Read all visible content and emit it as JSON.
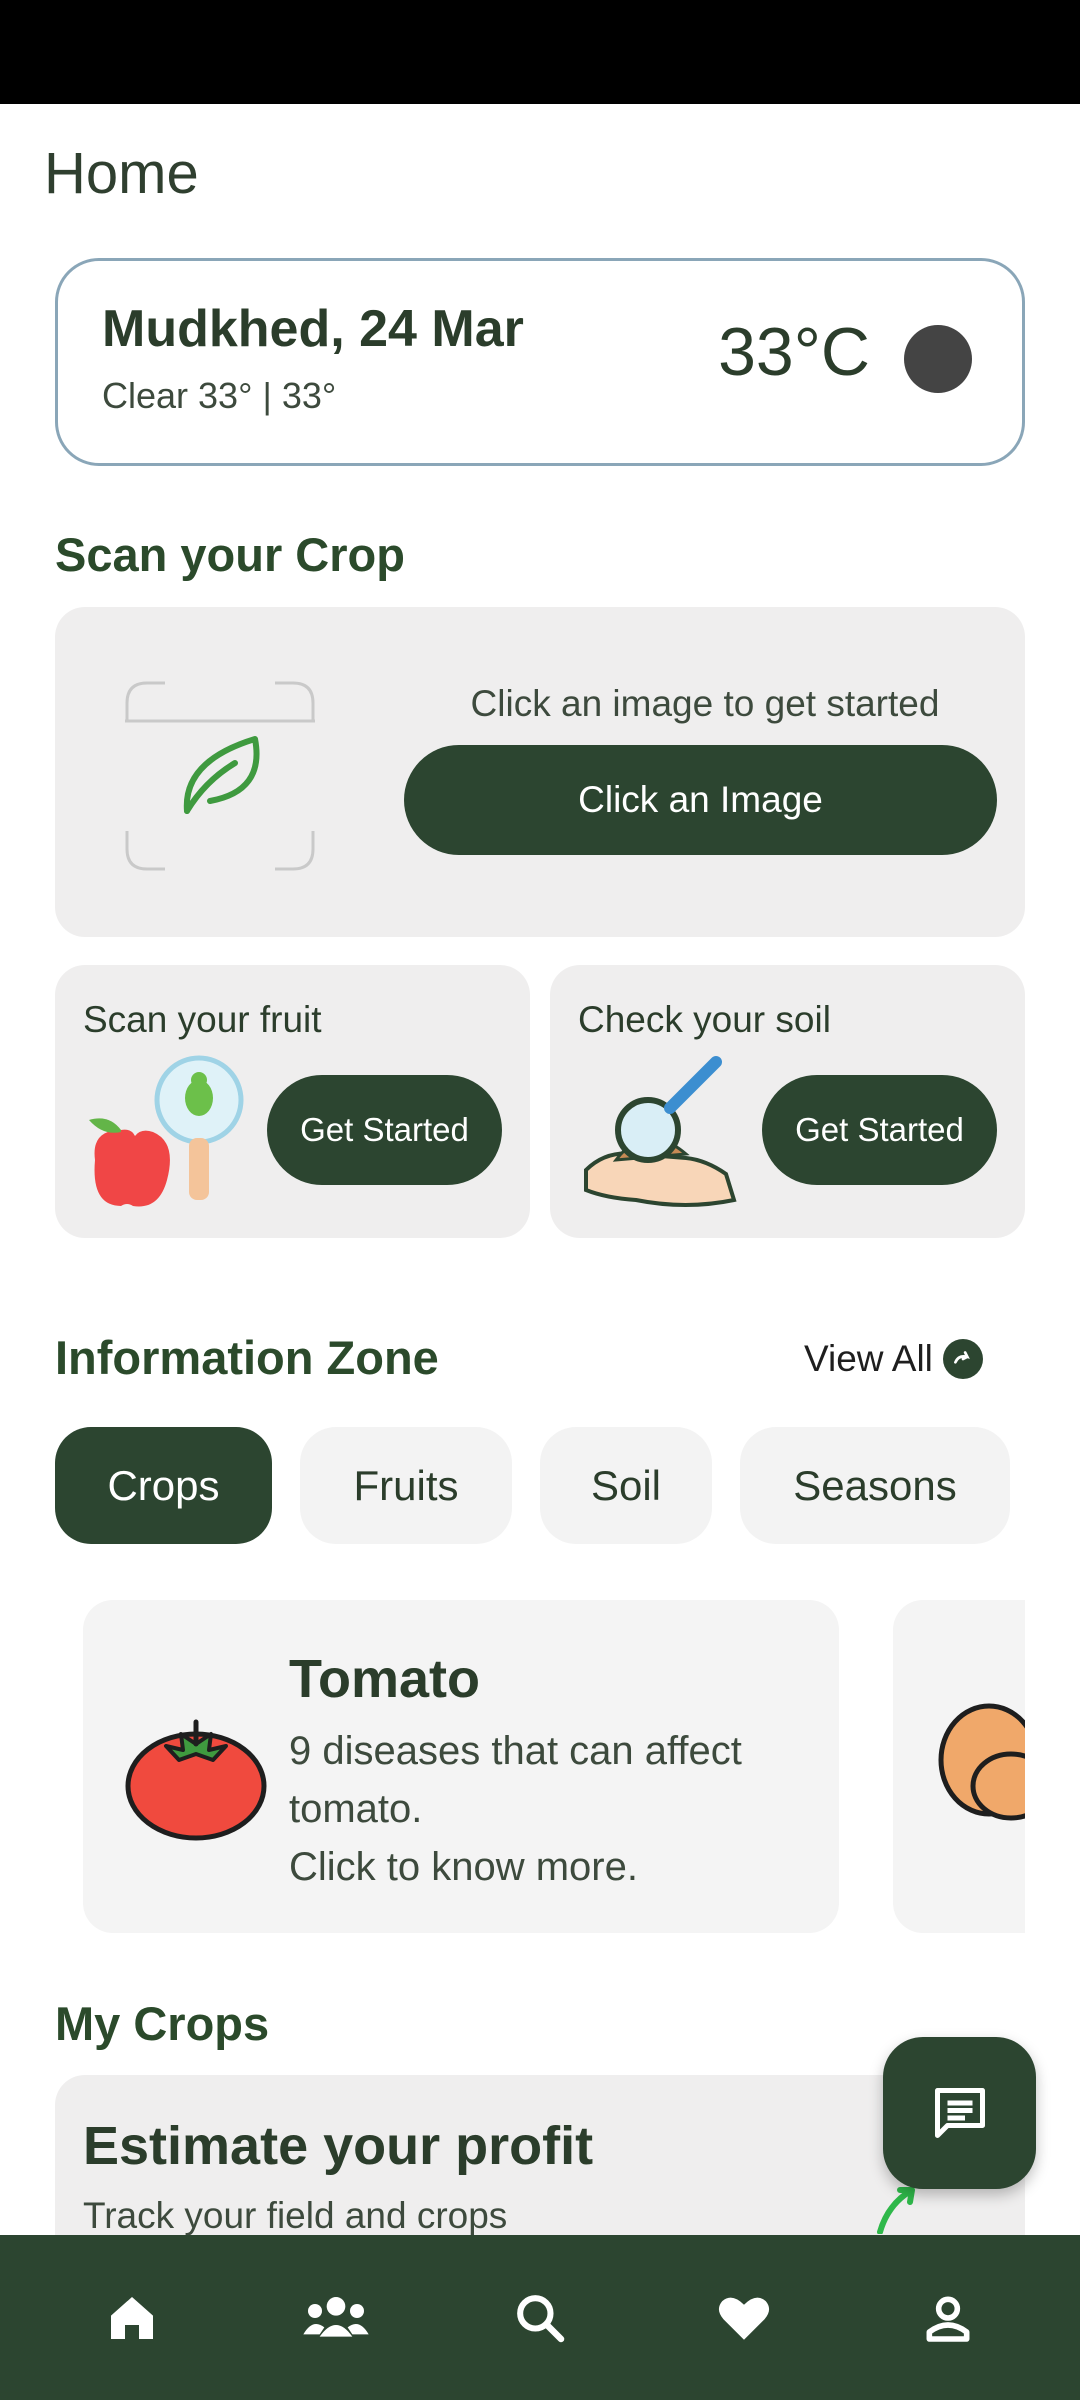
{
  "page": {
    "title": "Home"
  },
  "weather": {
    "location": "Mudkhed, 24 Mar",
    "condition": "Clear 33° | 33°",
    "temperature": "33°C"
  },
  "scan_section": {
    "title": "Scan your Crop",
    "hint": "Click an image to get started",
    "button_label": "Click an Image"
  },
  "mini_cards": [
    {
      "title": "Scan your fruit",
      "button_label": "Get Started"
    },
    {
      "title": "Check your soil",
      "button_label": "Get Started"
    }
  ],
  "info_zone": {
    "title": "Information Zone",
    "view_all": "View All",
    "tabs": [
      {
        "label": "Crops",
        "active": true
      },
      {
        "label": "Fruits",
        "active": false
      },
      {
        "label": "Soil",
        "active": false
      },
      {
        "label": "Seasons",
        "active": false
      }
    ],
    "cards": [
      {
        "title": "Tomato",
        "line1": "9 diseases that can affect",
        "line2": "tomato.",
        "line3": "Click to know more."
      }
    ]
  },
  "my_crops": {
    "title": "My Crops",
    "card_title": "Estimate your profit",
    "card_subtitle": "Track your field and crops"
  },
  "bottom_nav": [
    {
      "icon": "home-icon"
    },
    {
      "icon": "community-icon"
    },
    {
      "icon": "search-icon"
    },
    {
      "icon": "heart-icon"
    },
    {
      "icon": "profile-icon"
    }
  ],
  "colors": {
    "primary": "#2c4530",
    "card_bg": "#efeeee",
    "weather_border": "#8aa6b8"
  }
}
